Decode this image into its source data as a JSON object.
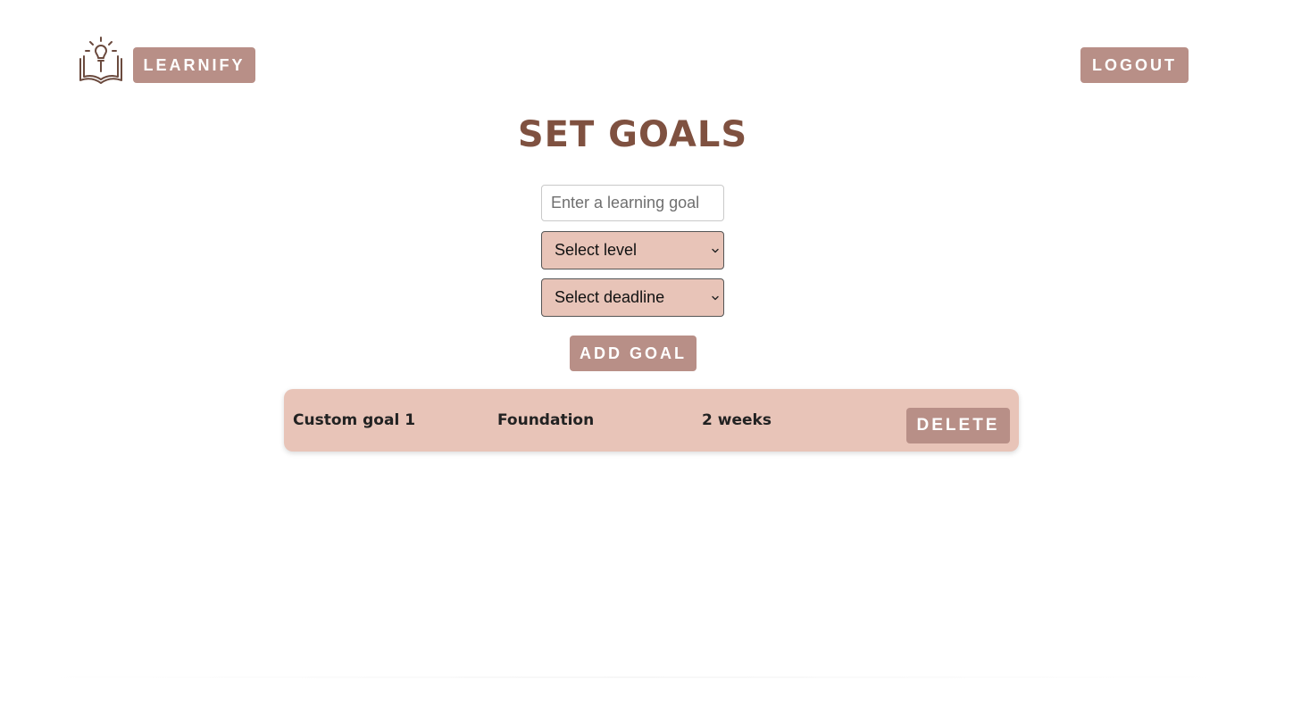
{
  "header": {
    "logo_icon": "book-lightbulb-icon",
    "brand_label": "LEARNIFY",
    "logout_label": "LOGOUT"
  },
  "main": {
    "title": "SET GOALS",
    "goal_input": {
      "placeholder": "Enter a learning goal",
      "value": ""
    },
    "level_select": {
      "selected": "Select level",
      "icon": "chevron-down-icon"
    },
    "deadline_select": {
      "selected": "Select deadline",
      "icon": "chevron-down-icon"
    },
    "add_goal_label": "ADD GOAL"
  },
  "goals": [
    {
      "name": "Custom goal 1",
      "level": "Foundation",
      "deadline": "2 weeks",
      "delete_label": "DELETE"
    }
  ],
  "colors": {
    "button_bg": "#b88f87",
    "button_text": "#ffffff",
    "title": "#7f5140",
    "select_bg": "#e8c4b8",
    "card_bg": "#e8c4b8",
    "logo_stroke": "#6b4a3e"
  }
}
